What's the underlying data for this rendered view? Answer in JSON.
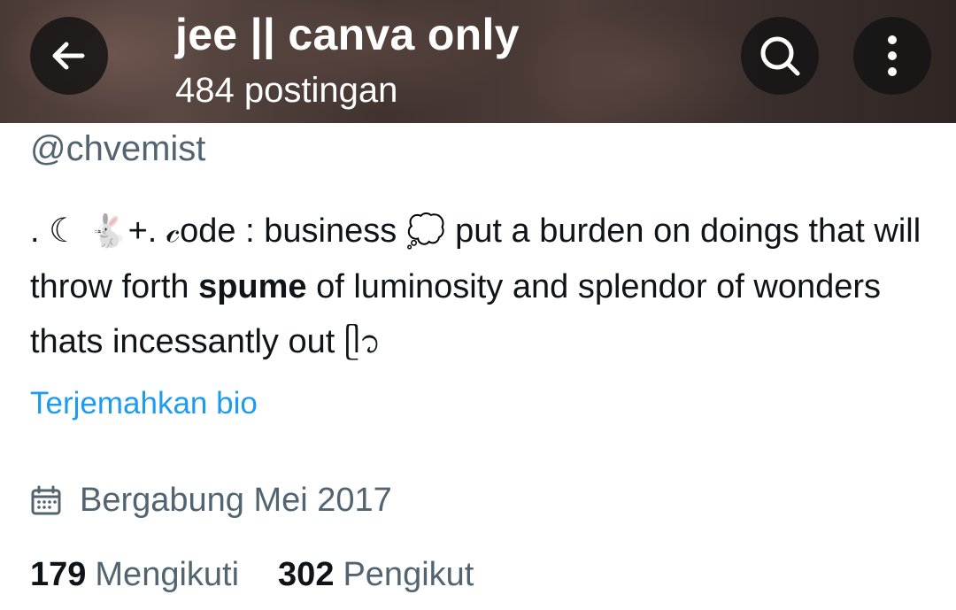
{
  "header": {
    "title": "jee || canva only",
    "subtitle": "484 postingan",
    "back_icon": "arrow-left-icon",
    "search_icon": "search-icon",
    "more_icon": "more-vertical-icon"
  },
  "profile": {
    "handle": "@chvemist",
    "bio": {
      "part1": ". ☾ ",
      "rabbit": "🐇",
      "part2": "+. 𝒸ode : business ",
      "thought": "💭",
      "part3": " put a burden on doings that will throw forth ",
      "bold": "spume",
      "part4": " of luminosity and splendor of wonders thats incessantly out ",
      "heart": "ᥫ᭡"
    },
    "translate_label": "Terjemahkan bio",
    "joined": "Bergabung Mei 2017",
    "calendar_icon": "calendar-icon",
    "following_count": "179",
    "following_label": "Mengikuti",
    "followers_count": "302",
    "followers_label": "Pengikut"
  },
  "colors": {
    "link": "#1d9bf0",
    "secondary_text": "#536471",
    "primary_text": "#0f1419"
  }
}
